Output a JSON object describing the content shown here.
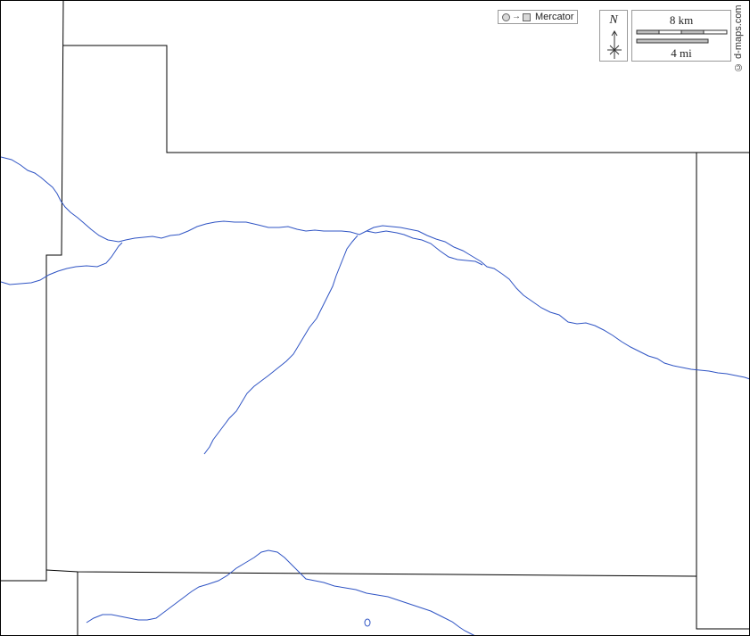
{
  "map": {
    "colors": {
      "boundary": "#000000",
      "river": "#2f54c4",
      "background": "#ffffff"
    },
    "legend": {
      "projection_label": "Mercator",
      "projection_from_icon": "globe-icon",
      "projection_to_icon": "flat-map-icon",
      "arrow_glyph": "→",
      "north_label": "N",
      "compass_icon": "compass-rose-icon",
      "scale_km_label": "8 km",
      "scale_mi_label": "4 mi"
    },
    "credit": "© d-maps.com"
  }
}
